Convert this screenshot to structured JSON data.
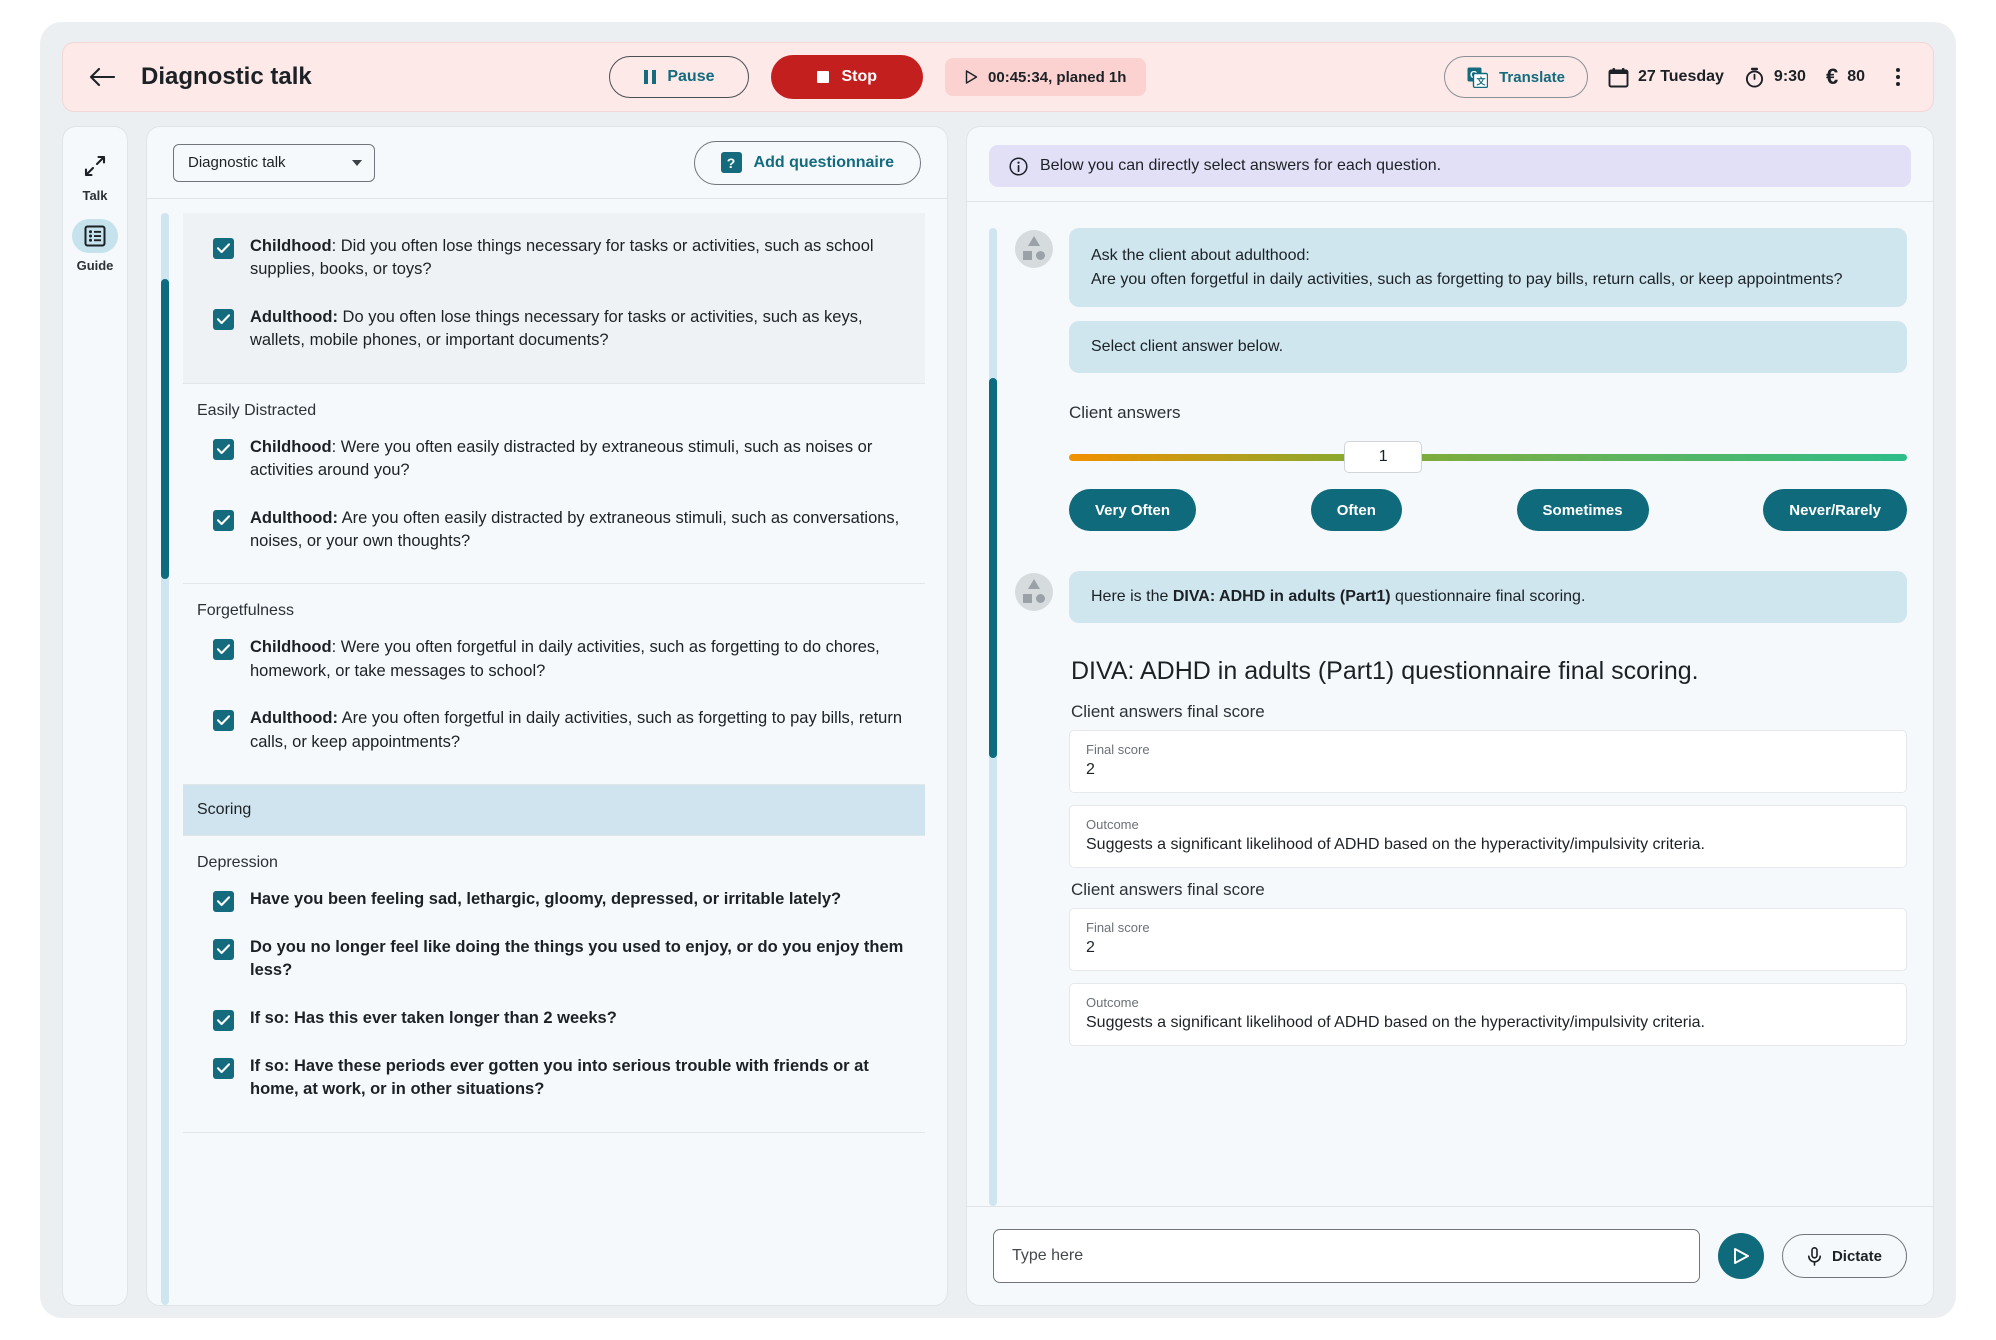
{
  "header": {
    "back_icon": "arrow-left-icon",
    "title": "Diagnostic talk",
    "pause_label": "Pause",
    "stop_label": "Stop",
    "timer_text": "00:45:34, planed 1h",
    "translate_label": "Translate",
    "date_text": "27 Tuesday",
    "time_text": "9:30",
    "price_text": "80",
    "currency_symbol": "€",
    "more_icon": "kebab-menu-icon",
    "accent_bg": "#fce9e8",
    "stop_color": "#c41f1f",
    "teal": "#136b7d"
  },
  "rail": {
    "items": [
      {
        "label": "Talk",
        "icon": "expand-arrows-icon",
        "active": false
      },
      {
        "label": "Guide",
        "icon": "list-guide-icon",
        "active": true
      }
    ]
  },
  "left_panel": {
    "select_value": "Diagnostic talk",
    "add_questionnaire_label": "Add questionnaire",
    "add_questionnaire_icon": "question-badge-icon",
    "groups": [
      {
        "kind": "clipped",
        "title": "",
        "shaded": true,
        "items": [
          {
            "lead": "Childhood",
            "sep": ": ",
            "text": "Did you often lose things necessary for tasks or activities, such as school supplies, books, or toys?",
            "checked": true,
            "bold": false
          },
          {
            "lead": "Adulthood:",
            "sep": " ",
            "text": "Do you often lose things necessary for tasks or activities, such as keys, wallets, mobile phones, or important documents?",
            "checked": true,
            "bold": false
          }
        ]
      },
      {
        "kind": "group",
        "title": "Easily Distracted",
        "shaded": false,
        "items": [
          {
            "lead": "Childhood",
            "sep": ": ",
            "text": "Were you often easily distracted by extraneous stimuli, such as noises or activities around you?",
            "checked": true,
            "bold": false
          },
          {
            "lead": "Adulthood:",
            "sep": " ",
            "text": "Are you often easily distracted by extraneous stimuli, such as conversations, noises, or your own thoughts?",
            "checked": true,
            "bold": false
          }
        ]
      },
      {
        "kind": "group",
        "title": "Forgetfulness",
        "shaded": false,
        "items": [
          {
            "lead": "Childhood",
            "sep": ": ",
            "text": "Were you often forgetful in daily activities, such as forgetting to do chores, homework, or take messages to school?",
            "checked": true,
            "bold": false
          },
          {
            "lead": "Adulthood:",
            "sep": " ",
            "text": "Are you often forgetful in daily activities, such as forgetting to pay bills, return calls, or keep appointments?",
            "checked": true,
            "bold": false
          }
        ]
      },
      {
        "kind": "banner",
        "title": "Scoring",
        "shaded": false,
        "items": []
      },
      {
        "kind": "group",
        "title": "Depression",
        "shaded": false,
        "items": [
          {
            "lead": "",
            "sep": "",
            "text": "Have you been feeling sad, lethargic, gloomy, depressed, or irritable lately?",
            "checked": true,
            "bold": true
          },
          {
            "lead": "",
            "sep": "",
            "text": "Do you no longer feel like doing the things you used to enjoy, or do you enjoy them less?",
            "checked": true,
            "bold": true
          },
          {
            "lead": "",
            "sep": "",
            "text": "If so: Has this ever taken longer than 2 weeks?",
            "checked": true,
            "bold": true
          },
          {
            "lead": "",
            "sep": "",
            "text": "If so: Have these periods ever gotten you into serious trouble with friends or at home, at work, or in other situations?",
            "checked": true,
            "bold": true
          }
        ]
      }
    ]
  },
  "right_panel": {
    "info_banner": "Below you can directly select answers for each question.",
    "info_icon": "info-circle-icon",
    "messages": [
      {
        "avatar": "assistant-avatar",
        "bubble_lines": [
          "Ask the client about adulthood:",
          "Are you often forgetful in daily activities, such as forgetting to pay bills, return calls, or keep appointments?"
        ],
        "second_bubble": "Select client answer below."
      }
    ],
    "answers": {
      "label": "Client answers",
      "slider_value": "1",
      "slider_percent": 37.5,
      "buttons": [
        "Very Often",
        "Often",
        "Sometimes",
        "Never/Rarely"
      ]
    },
    "scoring_message": {
      "prefix": "Here is the ",
      "bold": "DIVA: ADHD in adults (Part1)",
      "suffix": " questionnaire final scoring."
    },
    "scoring": {
      "title": "DIVA: ADHD in adults (Part1) questionnaire final scoring.",
      "sections": [
        {
          "heading": "Client answers final score",
          "score_label": "Final score",
          "score_value": "2",
          "outcome_label": "Outcome",
          "outcome_value": "Suggests a significant likelihood of ADHD based on the hyperactivity/impulsivity criteria."
        },
        {
          "heading": "Client answers final score",
          "score_label": "Final score",
          "score_value": "2",
          "outcome_label": "Outcome",
          "outcome_value": "Suggests a significant likelihood of ADHD based on the hyperactivity/impulsivity criteria."
        }
      ]
    },
    "composer": {
      "placeholder": "Type here",
      "value": "",
      "send_icon": "send-icon",
      "dictate_label": "Dictate",
      "dictate_icon": "microphone-icon"
    }
  }
}
